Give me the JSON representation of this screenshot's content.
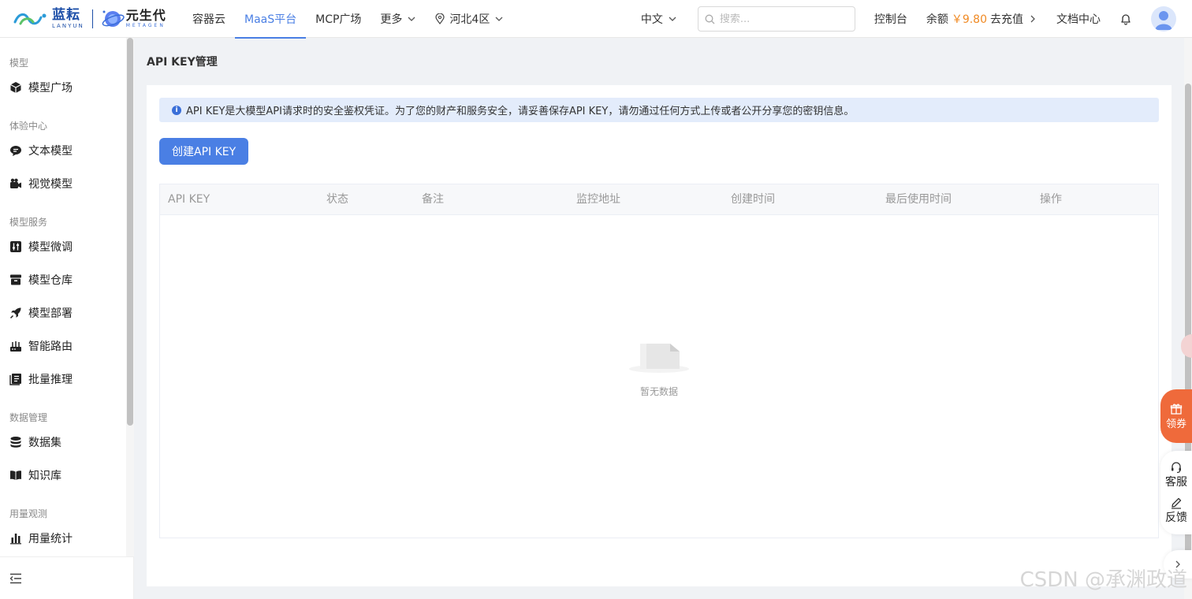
{
  "logo": {
    "brand1_cn": "蓝耘",
    "brand1_en": "LANYUN",
    "brand2_cn": "元生代",
    "brand2_en": "METAGEN"
  },
  "nav": {
    "items": [
      {
        "label": "容器云",
        "active": false
      },
      {
        "label": "MaaS平台",
        "active": true
      },
      {
        "label": "MCP广场",
        "active": false
      },
      {
        "label": "更多",
        "active": false
      }
    ],
    "region": "河北4区"
  },
  "topright": {
    "lang": "中文",
    "search_placeholder": "搜索...",
    "console": "控制台",
    "balance_label": "余额",
    "balance_amount": "￥9.80",
    "recharge": "去充值",
    "docs": "文档中心"
  },
  "sidebar": {
    "groups": [
      {
        "title": "模型",
        "items": [
          "模型广场"
        ]
      },
      {
        "title": "体验中心",
        "items": [
          "文本模型",
          "视觉模型"
        ]
      },
      {
        "title": "模型服务",
        "items": [
          "模型微调",
          "模型仓库",
          "模型部署",
          "智能路由",
          "批量推理"
        ]
      },
      {
        "title": "数据管理",
        "items": [
          "数据集",
          "知识库"
        ]
      },
      {
        "title": "用量观测",
        "items": [
          "用量统计"
        ]
      }
    ]
  },
  "page": {
    "title": "API KEY管理",
    "alert": "API KEY是大模型API请求时的安全鉴权凭证。为了您的财产和服务安全，请妥善保存API KEY，请勿通过任何方式上传或者公开分享您的密钥信息。",
    "create_button": "创建API KEY",
    "columns": [
      "API KEY",
      "状态",
      "备注",
      "监控地址",
      "创建时间",
      "最后使用时间",
      "操作"
    ],
    "empty_text": "暂无数据"
  },
  "floating": {
    "coupon": "领券",
    "service": "客服",
    "feedback": "反馈"
  },
  "watermark": "CSDN @承渊政道",
  "colors": {
    "accent": "#4a7fe4",
    "balance": "#f08a24",
    "coupon": "#ef6a3b",
    "alert_bg": "#e3ecfb"
  }
}
